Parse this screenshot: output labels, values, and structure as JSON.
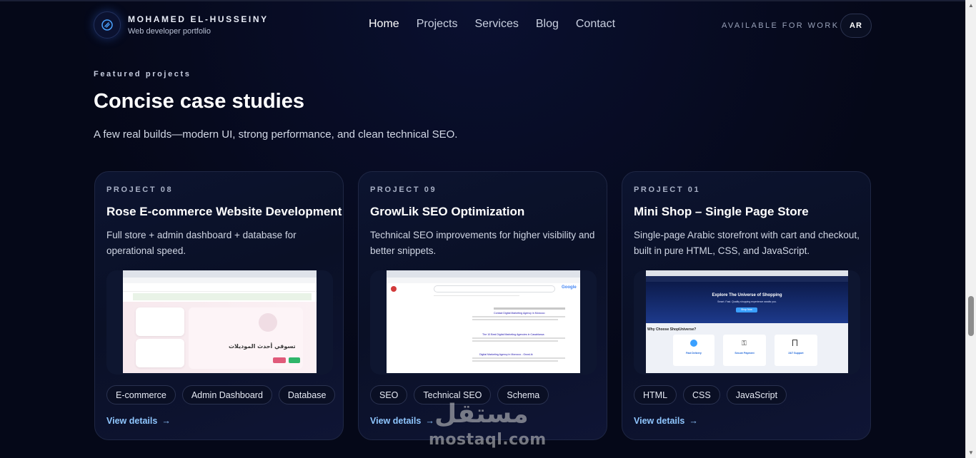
{
  "header": {
    "brand_name": "MOHAMED EL-HUSSEINY",
    "brand_sub": "Web developer portfolio",
    "nav": [
      "Home",
      "Projects",
      "Services",
      "Blog",
      "Contact"
    ],
    "availability": "AVAILABLE FOR WORK",
    "lang_button": "AR"
  },
  "section": {
    "eyebrow": "Featured projects",
    "title": "Concise case studies",
    "lead": "A few real builds—modern UI, strong performance, and clean technical SEO."
  },
  "cards": [
    {
      "num": "PROJECT 08",
      "title": "Rose E-commerce Website Development",
      "desc": "Full store + admin dashboard + database for operational speed.",
      "tags": [
        "E-commerce",
        "Admin Dashboard",
        "Database"
      ],
      "link": "View details",
      "shot_text": {
        "headline": "تسوقي أحدث الموديلات"
      }
    },
    {
      "num": "PROJECT 09",
      "title": "GrowLik SEO Optimization",
      "desc": "Technical SEO improvements for higher visibility and better snippets.",
      "tags": [
        "SEO",
        "Technical SEO",
        "Schema"
      ],
      "link": "View details",
      "shot_text": {
        "logo": "Google",
        "results": [
          "Contact Digital Marketing Agency in Morocco",
          "The 10 Best Digital Marketing Agencies in Casablanca",
          "Digital Marketing Agency in Morocco - GrowLik"
        ]
      }
    },
    {
      "num": "PROJECT 01",
      "title": "Mini Shop – Single Page Store",
      "desc": "Single-page Arabic storefront with cart and checkout, built in pure HTML, CSS, and JavaScript.",
      "tags": [
        "HTML",
        "CSS",
        "JavaScript"
      ],
      "link": "View details",
      "shot_text": {
        "hero": "Explore The Universe of Shopping",
        "sub": "Smart. Fast. Quality shopping experience awaits you.",
        "cta": "Shop Now",
        "why": "Why Choose ShopUniverse?",
        "features": [
          "Fast Delivery",
          "Secure Payment",
          "24/7 Support"
        ]
      }
    }
  ],
  "scrollbar": {
    "position": 0.72
  },
  "watermark": {
    "arabic": "مستقل",
    "latin": "mostaql.com"
  }
}
